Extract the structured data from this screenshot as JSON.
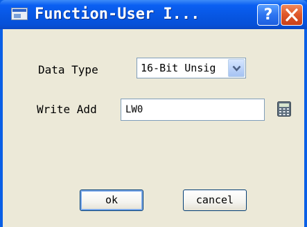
{
  "window": {
    "title": "Function-User I...",
    "help_label": "?"
  },
  "form": {
    "data_type_label": "Data Type",
    "data_type_value": "16-Bit Unsig",
    "write_add_label": "Write Add",
    "write_add_value": "LW0"
  },
  "buttons": {
    "ok_label": "ok",
    "cancel_label": "cancel"
  },
  "icons": {
    "app": "window-icon",
    "help": "help-icon",
    "close": "close-icon",
    "dropdown": "chevron-down-icon",
    "calculator": "calculator-icon"
  },
  "colors": {
    "titlebar": "#0756e2",
    "client_bg": "#ece9d8",
    "close_button": "#e15a2c"
  }
}
